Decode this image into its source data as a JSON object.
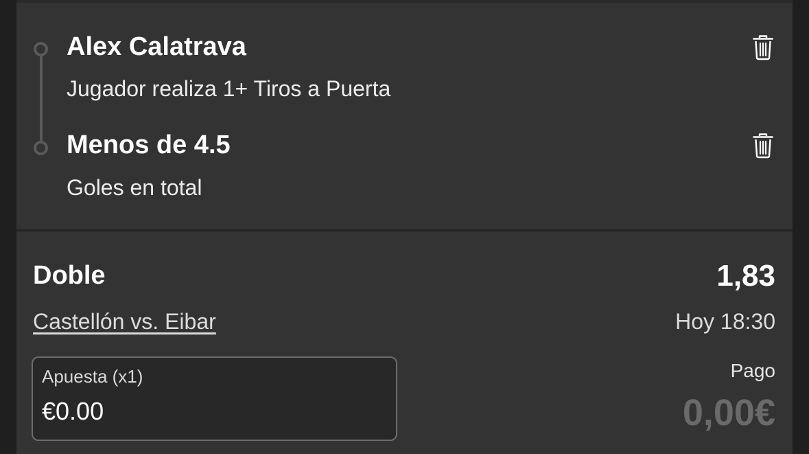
{
  "selections": [
    {
      "title": "Alex Calatrava",
      "market": "Jugador realiza 1+ Tiros a Puerta",
      "delete_icon": "trash-icon"
    },
    {
      "title": "Menos de 4.5",
      "market": "Goles en total",
      "delete_icon": "trash-icon"
    }
  ],
  "bet": {
    "type": "Doble",
    "odds": "1,83",
    "event": "Castellón vs. Eibar",
    "time": "Hoy 18:30"
  },
  "stake": {
    "label": "Apuesta (x1)",
    "value": "€0.00"
  },
  "payout": {
    "label": "Pago",
    "value": "0,00€"
  },
  "colors": {
    "background": "#1f1f1f",
    "card": "#333333",
    "payout_muted": "#6a6a6a"
  }
}
